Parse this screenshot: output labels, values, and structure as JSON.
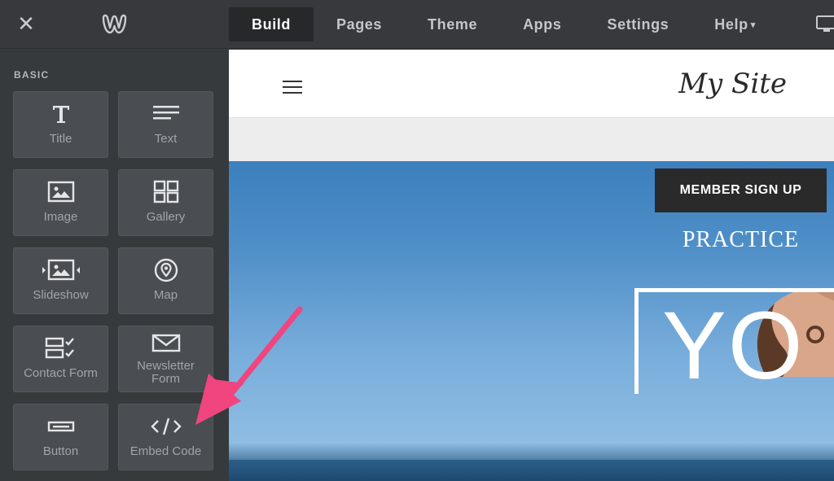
{
  "topbar": {
    "close_label": "✕",
    "tabs": [
      {
        "label": "Build",
        "active": true
      },
      {
        "label": "Pages"
      },
      {
        "label": "Theme"
      },
      {
        "label": "Apps"
      },
      {
        "label": "Settings"
      },
      {
        "label": "Help",
        "has_caret": true
      }
    ],
    "caret_glyph": "▾",
    "icons": {
      "logo": "weebly-logo-icon",
      "close": "close-icon",
      "device": "desktop-monitor-icon"
    }
  },
  "sidebar": {
    "section_label": "BASIC",
    "elements": [
      {
        "label": "Title",
        "icon": "title-icon"
      },
      {
        "label": "Text",
        "icon": "text-icon"
      },
      {
        "label": "Image",
        "icon": "image-icon"
      },
      {
        "label": "Gallery",
        "icon": "gallery-icon"
      },
      {
        "label": "Slideshow",
        "icon": "slideshow-icon"
      },
      {
        "label": "Map",
        "icon": "map-pin-icon"
      },
      {
        "label": "Contact Form",
        "icon": "contact-form-icon"
      },
      {
        "label_line1": "Newsletter",
        "label_line2": "Form",
        "icon": "envelope-icon"
      },
      {
        "label": "Button",
        "icon": "button-icon"
      },
      {
        "label": "Embed Code",
        "icon": "code-icon"
      }
    ]
  },
  "site": {
    "title": "My Site",
    "member_button": "MEMBER SIGN UP",
    "tagline": "PRACTICE",
    "hero_letters": "YO"
  },
  "colors": {
    "topbar_bg": "#37393c",
    "sidebar_bg": "#363a3d",
    "tile_bg": "#4a4e52",
    "arrow": "#f0457f",
    "hero_sky": "#5291c9"
  }
}
